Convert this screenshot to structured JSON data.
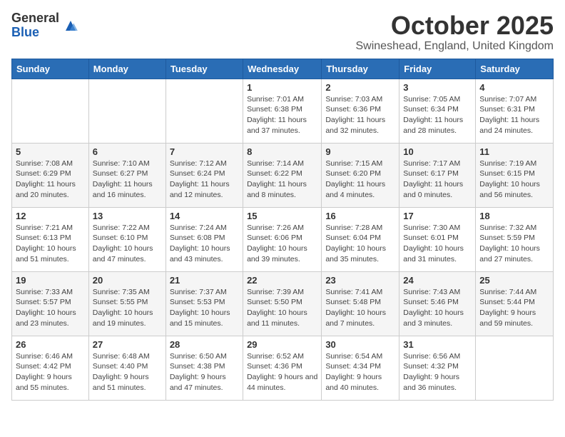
{
  "logo": {
    "general": "General",
    "blue": "Blue"
  },
  "header": {
    "title": "October 2025",
    "location": "Swineshead, England, United Kingdom"
  },
  "weekdays": [
    "Sunday",
    "Monday",
    "Tuesday",
    "Wednesday",
    "Thursday",
    "Friday",
    "Saturday"
  ],
  "weeks": [
    [
      {
        "day": "",
        "info": ""
      },
      {
        "day": "",
        "info": ""
      },
      {
        "day": "",
        "info": ""
      },
      {
        "day": "1",
        "info": "Sunrise: 7:01 AM\nSunset: 6:38 PM\nDaylight: 11 hours\nand 37 minutes."
      },
      {
        "day": "2",
        "info": "Sunrise: 7:03 AM\nSunset: 6:36 PM\nDaylight: 11 hours\nand 32 minutes."
      },
      {
        "day": "3",
        "info": "Sunrise: 7:05 AM\nSunset: 6:34 PM\nDaylight: 11 hours\nand 28 minutes."
      },
      {
        "day": "4",
        "info": "Sunrise: 7:07 AM\nSunset: 6:31 PM\nDaylight: 11 hours\nand 24 minutes."
      }
    ],
    [
      {
        "day": "5",
        "info": "Sunrise: 7:08 AM\nSunset: 6:29 PM\nDaylight: 11 hours\nand 20 minutes."
      },
      {
        "day": "6",
        "info": "Sunrise: 7:10 AM\nSunset: 6:27 PM\nDaylight: 11 hours\nand 16 minutes."
      },
      {
        "day": "7",
        "info": "Sunrise: 7:12 AM\nSunset: 6:24 PM\nDaylight: 11 hours\nand 12 minutes."
      },
      {
        "day": "8",
        "info": "Sunrise: 7:14 AM\nSunset: 6:22 PM\nDaylight: 11 hours\nand 8 minutes."
      },
      {
        "day": "9",
        "info": "Sunrise: 7:15 AM\nSunset: 6:20 PM\nDaylight: 11 hours\nand 4 minutes."
      },
      {
        "day": "10",
        "info": "Sunrise: 7:17 AM\nSunset: 6:17 PM\nDaylight: 11 hours\nand 0 minutes."
      },
      {
        "day": "11",
        "info": "Sunrise: 7:19 AM\nSunset: 6:15 PM\nDaylight: 10 hours\nand 56 minutes."
      }
    ],
    [
      {
        "day": "12",
        "info": "Sunrise: 7:21 AM\nSunset: 6:13 PM\nDaylight: 10 hours\nand 51 minutes."
      },
      {
        "day": "13",
        "info": "Sunrise: 7:22 AM\nSunset: 6:10 PM\nDaylight: 10 hours\nand 47 minutes."
      },
      {
        "day": "14",
        "info": "Sunrise: 7:24 AM\nSunset: 6:08 PM\nDaylight: 10 hours\nand 43 minutes."
      },
      {
        "day": "15",
        "info": "Sunrise: 7:26 AM\nSunset: 6:06 PM\nDaylight: 10 hours\nand 39 minutes."
      },
      {
        "day": "16",
        "info": "Sunrise: 7:28 AM\nSunset: 6:04 PM\nDaylight: 10 hours\nand 35 minutes."
      },
      {
        "day": "17",
        "info": "Sunrise: 7:30 AM\nSunset: 6:01 PM\nDaylight: 10 hours\nand 31 minutes."
      },
      {
        "day": "18",
        "info": "Sunrise: 7:32 AM\nSunset: 5:59 PM\nDaylight: 10 hours\nand 27 minutes."
      }
    ],
    [
      {
        "day": "19",
        "info": "Sunrise: 7:33 AM\nSunset: 5:57 PM\nDaylight: 10 hours\nand 23 minutes."
      },
      {
        "day": "20",
        "info": "Sunrise: 7:35 AM\nSunset: 5:55 PM\nDaylight: 10 hours\nand 19 minutes."
      },
      {
        "day": "21",
        "info": "Sunrise: 7:37 AM\nSunset: 5:53 PM\nDaylight: 10 hours\nand 15 minutes."
      },
      {
        "day": "22",
        "info": "Sunrise: 7:39 AM\nSunset: 5:50 PM\nDaylight: 10 hours\nand 11 minutes."
      },
      {
        "day": "23",
        "info": "Sunrise: 7:41 AM\nSunset: 5:48 PM\nDaylight: 10 hours\nand 7 minutes."
      },
      {
        "day": "24",
        "info": "Sunrise: 7:43 AM\nSunset: 5:46 PM\nDaylight: 10 hours\nand 3 minutes."
      },
      {
        "day": "25",
        "info": "Sunrise: 7:44 AM\nSunset: 5:44 PM\nDaylight: 9 hours\nand 59 minutes."
      }
    ],
    [
      {
        "day": "26",
        "info": "Sunrise: 6:46 AM\nSunset: 4:42 PM\nDaylight: 9 hours\nand 55 minutes."
      },
      {
        "day": "27",
        "info": "Sunrise: 6:48 AM\nSunset: 4:40 PM\nDaylight: 9 hours\nand 51 minutes."
      },
      {
        "day": "28",
        "info": "Sunrise: 6:50 AM\nSunset: 4:38 PM\nDaylight: 9 hours\nand 47 minutes."
      },
      {
        "day": "29",
        "info": "Sunrise: 6:52 AM\nSunset: 4:36 PM\nDaylight: 9 hours\nand 44 minutes."
      },
      {
        "day": "30",
        "info": "Sunrise: 6:54 AM\nSunset: 4:34 PM\nDaylight: 9 hours\nand 40 minutes."
      },
      {
        "day": "31",
        "info": "Sunrise: 6:56 AM\nSunset: 4:32 PM\nDaylight: 9 hours\nand 36 minutes."
      },
      {
        "day": "",
        "info": ""
      }
    ]
  ]
}
